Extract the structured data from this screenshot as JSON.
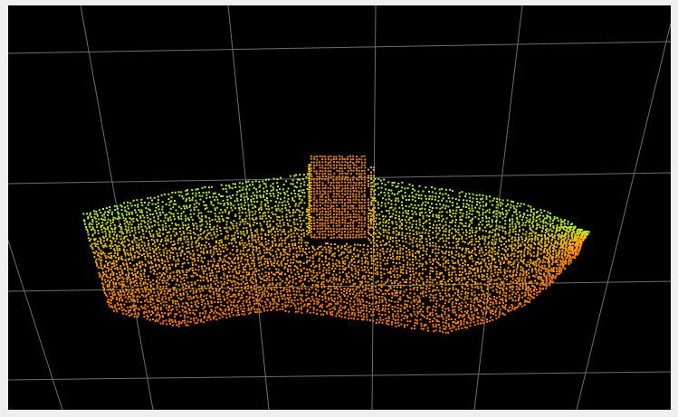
{
  "viewer": {
    "background_color": "#000000",
    "frame_color": "#efefef",
    "grid_color": "#6e6e6e",
    "object": "point-cloud",
    "colormap": {
      "near": "#ff7a00",
      "mid": "#ffb000",
      "far": "#a8ff30",
      "box": "#e8821f"
    }
  }
}
